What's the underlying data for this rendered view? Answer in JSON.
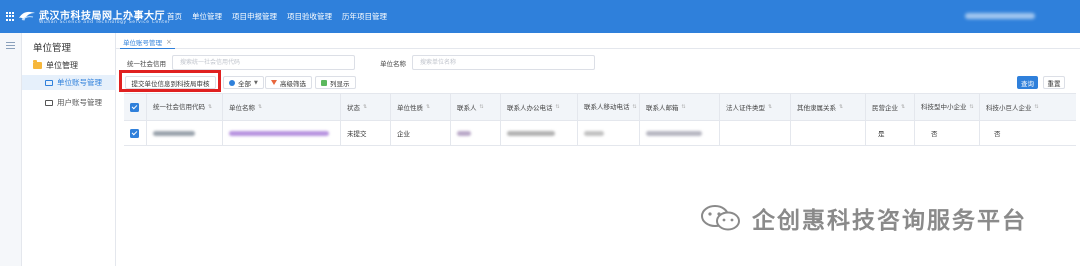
{
  "header": {
    "brand_title": "武汉市科技局网上办事大厅",
    "brand_subtitle": "Wuhan Science and Technology Service Center",
    "nav": [
      "首页",
      "单位管理",
      "项目申报管理",
      "项目验收管理",
      "历年项目管理"
    ],
    "colors": {
      "topbar": "#2f80db",
      "accent": "#2f80db",
      "highlight_frame": "#e02020"
    }
  },
  "sidebar": {
    "title": "单位管理",
    "group": "单位管理",
    "items": [
      {
        "label": "单位账号管理",
        "active": true
      },
      {
        "label": "用户账号管理",
        "active": false
      }
    ]
  },
  "tab": {
    "label": "单位账号管理"
  },
  "filters": {
    "credit_code_label": "统一社会信用",
    "credit_code_placeholder": "搜索统一社会信用代码",
    "name_label": "单位名称",
    "name_placeholder": "搜索单位名称"
  },
  "toolbar": {
    "submit_label": "提交单位信息到科技局审核",
    "all_label": "全部",
    "advanced_label": "高级筛选",
    "columns_label": "列显示",
    "query_label": "查询",
    "reset_label": "重置"
  },
  "table": {
    "headers": [
      "统一社会信用代码",
      "单位名称",
      "状态",
      "单位性质",
      "联系人",
      "联系人办公电话",
      "联系人移动电话",
      "联系人邮箱",
      "法人证件类型",
      "其他隶属关系",
      "民营企业",
      "科技型中小企业",
      "科技小巨人企业"
    ],
    "rows": [
      {
        "checked": true,
        "status": "未提交",
        "nature": "企业",
        "private": "是",
        "sme": "否",
        "giant": "否"
      }
    ]
  },
  "watermark": {
    "text": "企创惠科技咨询服务平台",
    "icon": "wechat-icon"
  }
}
